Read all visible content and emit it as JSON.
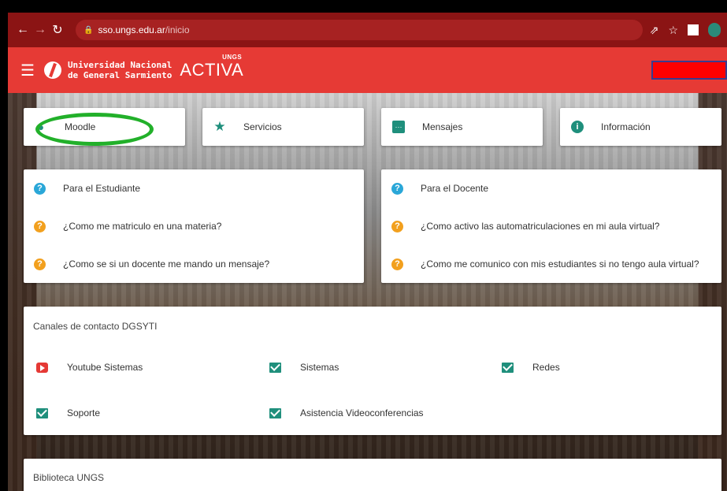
{
  "browser": {
    "url_host": "sso.ungs.edu.ar",
    "url_path": "/inicio",
    "icons": [
      "back-icon",
      "forward-icon",
      "reload-icon",
      "lock-icon",
      "share-icon",
      "star-icon",
      "extension-icon",
      "profile-icon"
    ]
  },
  "header": {
    "university_line1": "Universidad Nacional",
    "university_line2": "de General Sarmiento",
    "brand": "ACTIVA",
    "brand_sup": "UNGS",
    "accent_color": "#e63a35"
  },
  "tiles": [
    {
      "label": "Moodle",
      "icon": "moodle-icon"
    },
    {
      "label": "Servicios",
      "icon": "star-icon"
    },
    {
      "label": "Mensajes",
      "icon": "message-icon"
    },
    {
      "label": "Información",
      "icon": "info-icon"
    }
  ],
  "faq_student": {
    "heading": "Para el Estudiante",
    "items": [
      "¿Como me matriculo en una materia?",
      "¿Como se si un docente me mando un mensaje?"
    ]
  },
  "faq_teacher": {
    "heading": "Para el Docente",
    "items": [
      "¿Como activo las automatriculaciones en mi aula virtual?",
      "¿Como me comunico con mis estudiantes si no tengo aula virtual?"
    ]
  },
  "contact": {
    "title": "Canales de contacto DGSYTI",
    "items": [
      {
        "label": "Youtube Sistemas",
        "icon": "youtube-icon"
      },
      {
        "label": "Sistemas",
        "icon": "mail-icon"
      },
      {
        "label": "Redes",
        "icon": "mail-icon"
      },
      {
        "label": "Soporte",
        "icon": "mail-icon"
      },
      {
        "label": "Asistencia Videoconferencias",
        "icon": "mail-icon"
      }
    ]
  },
  "library": {
    "title": "Biblioteca UNGS"
  }
}
